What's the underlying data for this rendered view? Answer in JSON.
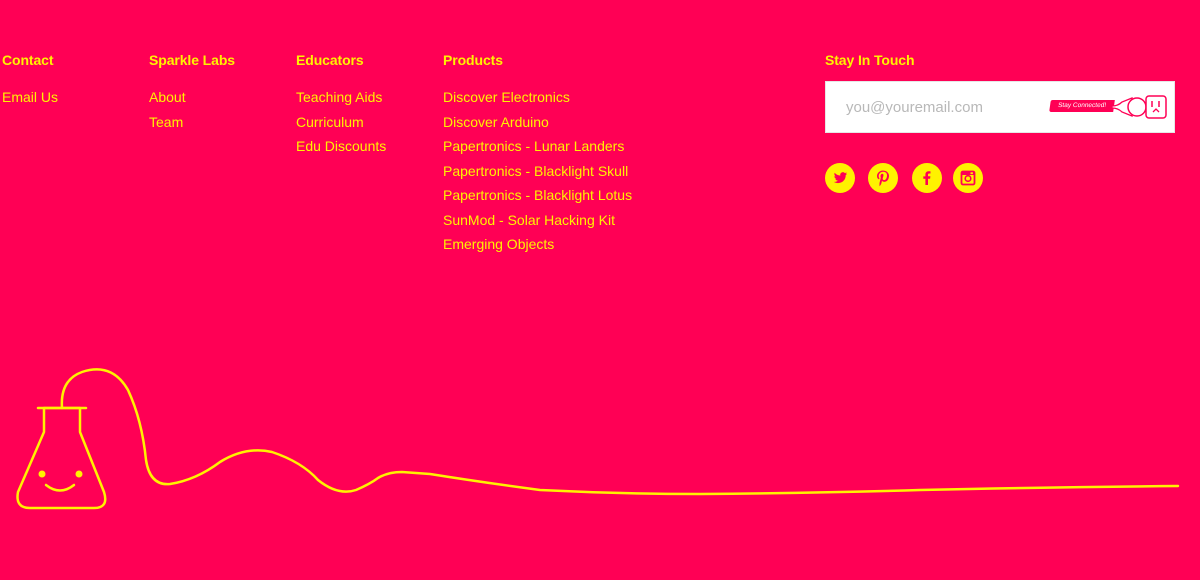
{
  "columns": {
    "contact": {
      "heading": "Contact",
      "links": [
        "Email Us"
      ]
    },
    "sparkle_labs": {
      "heading": "Sparkle Labs",
      "links": [
        "About",
        "Team"
      ]
    },
    "educators": {
      "heading": "Educators",
      "links": [
        "Teaching Aids",
        "Curriculum",
        "Edu Discounts"
      ]
    },
    "products": {
      "heading": "Products",
      "links": [
        "Discover Electronics",
        "Discover Arduino",
        "Papertronics - Lunar Landers",
        "Papertronics - Blacklight Skull",
        "Papertronics - Blacklight Lotus",
        "SunMod - Solar Hacking Kit",
        "Emerging Objects"
      ]
    }
  },
  "stay_in_touch": {
    "heading": "Stay In Touch",
    "email_placeholder": "you@youremail.com",
    "submit_label": "Stay Connected!"
  },
  "social": [
    "twitter-icon",
    "pinterest-icon",
    "facebook-icon",
    "instagram-icon"
  ],
  "colors": {
    "background": "#ff0055",
    "accent": "#fff200",
    "input_bg": "#ffffff"
  }
}
